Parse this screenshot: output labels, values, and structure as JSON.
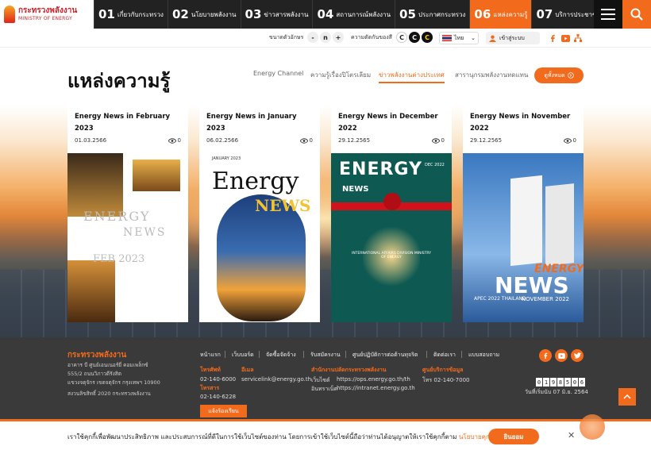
{
  "logo": {
    "th": "กระทรวงพลังงาน",
    "en": "MINISTRY OF ENERGY"
  },
  "menu": [
    {
      "num": "01",
      "label": "เกี่ยวกับกระทรวง"
    },
    {
      "num": "02",
      "label": "นโยบายพลังงาน"
    },
    {
      "num": "03",
      "label": "ข่าวสารพลังงาน"
    },
    {
      "num": "04",
      "label": "สถานการณ์พลังงาน"
    },
    {
      "num": "05",
      "label": "ประกาศกระทรวง"
    },
    {
      "num": "06",
      "label": "แหล่งความรู้"
    },
    {
      "num": "07",
      "label": "บริการประชาชน"
    }
  ],
  "utility": {
    "font_size_label": "ขนาดตัวอักษร",
    "font_minus": "-",
    "font_normal": "n",
    "font_plus": "+",
    "contrast_label": "ความตัดกันของสี",
    "contrast_options": [
      "C",
      "C",
      "C"
    ],
    "language": "ไทย",
    "login": "เข้าสู่ระบบ"
  },
  "page": {
    "title": "แหล่งความรู้",
    "see_all": "ดูทั้งหมด"
  },
  "tabs": [
    "Energy Channel",
    "ความรู้เรื่องปิโตรเลียม",
    "ข่าวพลังงานต่างประเทศ",
    "สารานุกรมพลังงานทดแทน"
  ],
  "cards": [
    {
      "title": "Energy News in February 2023",
      "date": "01.03.2566",
      "views": "0",
      "cover_line1": "ENERGY",
      "cover_line2": "NEWS",
      "cover_line3": "FEB 2023"
    },
    {
      "title": "Energy News in January 2023",
      "date": "06.02.2566",
      "views": "0",
      "cover_line1": "Energy",
      "cover_line2": "NEWS",
      "cover_small": "JANUARY 2023"
    },
    {
      "title": "Energy News in December 2022",
      "date": "29.12.2565",
      "views": "0",
      "cover_line1": "ENERGY",
      "cover_line2": "NEWS",
      "cover_small": "DEC 2022",
      "cover_footer": "INTERNATIONAL AFFAIRS DIVISION MINISTRY OF ENERGY"
    },
    {
      "title": "Energy News in November 2022",
      "date": "29.12.2565",
      "views": "0",
      "cover_line1": "ENERGY",
      "cover_line2": "NEWS",
      "cover_small": "NOVEMBER 2022",
      "cover_apec": "APEC 2022 THAILAND"
    }
  ],
  "footer": {
    "org": "กระทรวงพลังงาน",
    "address": "อาคาร บี ศูนย์เอนเนอร์ยี่ คอมเพล็กซ์\n555/2 ถนนวิภาวดีรังสิต\nแขวงจตุจักร เขตจตุจักร กรุงเทพฯ 10900",
    "copyright": "สงวนลิขสิทธิ์ 2020 กระทรวงพลังงาน",
    "links": [
      "หน้าแรก",
      "เว็บบอร์ด",
      "จัดซื้อจัดจ้าง",
      "รับสมัครงาน",
      "ศูนย์ปฏิบัติการต่อต้านทุจริต",
      "ติดต่อเรา",
      "แบบสอบถาม"
    ],
    "phone_label": "โทรศัพท์",
    "phone": "02-140-6000",
    "fax_label": "โทรสาร",
    "fax": "02-140-6228",
    "email_label": "อีเมล",
    "email": "servicelink@energy.go.th",
    "ops_label": "สำนักงานปลัดกระทรวงพลังงาน",
    "website_label": "เว็บไซต์",
    "ops_site": "https://ops.energy.go.th/th",
    "intranet_label": "อินทราเน็ต",
    "intranet": "https://intranet.energy.go.th",
    "info_label": "ศูนย์บริการข้อมูล",
    "info_phone": "โทร 02-140-7000",
    "counter": [
      "0",
      "1",
      "9",
      "8",
      "5",
      "0",
      "6"
    ],
    "since": "วันที่เริ่มนับ 07 มิ.ย. 2564",
    "report": "แจ้งร้องเรียน"
  },
  "cookie": {
    "text": "เราใช้คุกกี้เพื่อพัฒนาประสิทธิภาพ และประสบการณ์ที่ดีในการใช้เว็บไซต์ของท่าน โดยการเข้าใช้เว็บไซต์นี้ถือว่าท่านได้อนุญาตให้เราใช้คุกกี้ตาม",
    "link": "นโยบายคุกกี้",
    "accept": "ยินยอม",
    "close": "✕"
  },
  "colors": {
    "accent": "#f26b1d",
    "nav": "#222222",
    "footer": "#3a3a3a"
  },
  "icons": [
    "search-icon",
    "menu-icon",
    "user-icon",
    "facebook-icon",
    "youtube-icon",
    "sitemap-icon",
    "eye-icon",
    "arrow-right-icon",
    "twitter-icon",
    "chevron-up-icon"
  ]
}
